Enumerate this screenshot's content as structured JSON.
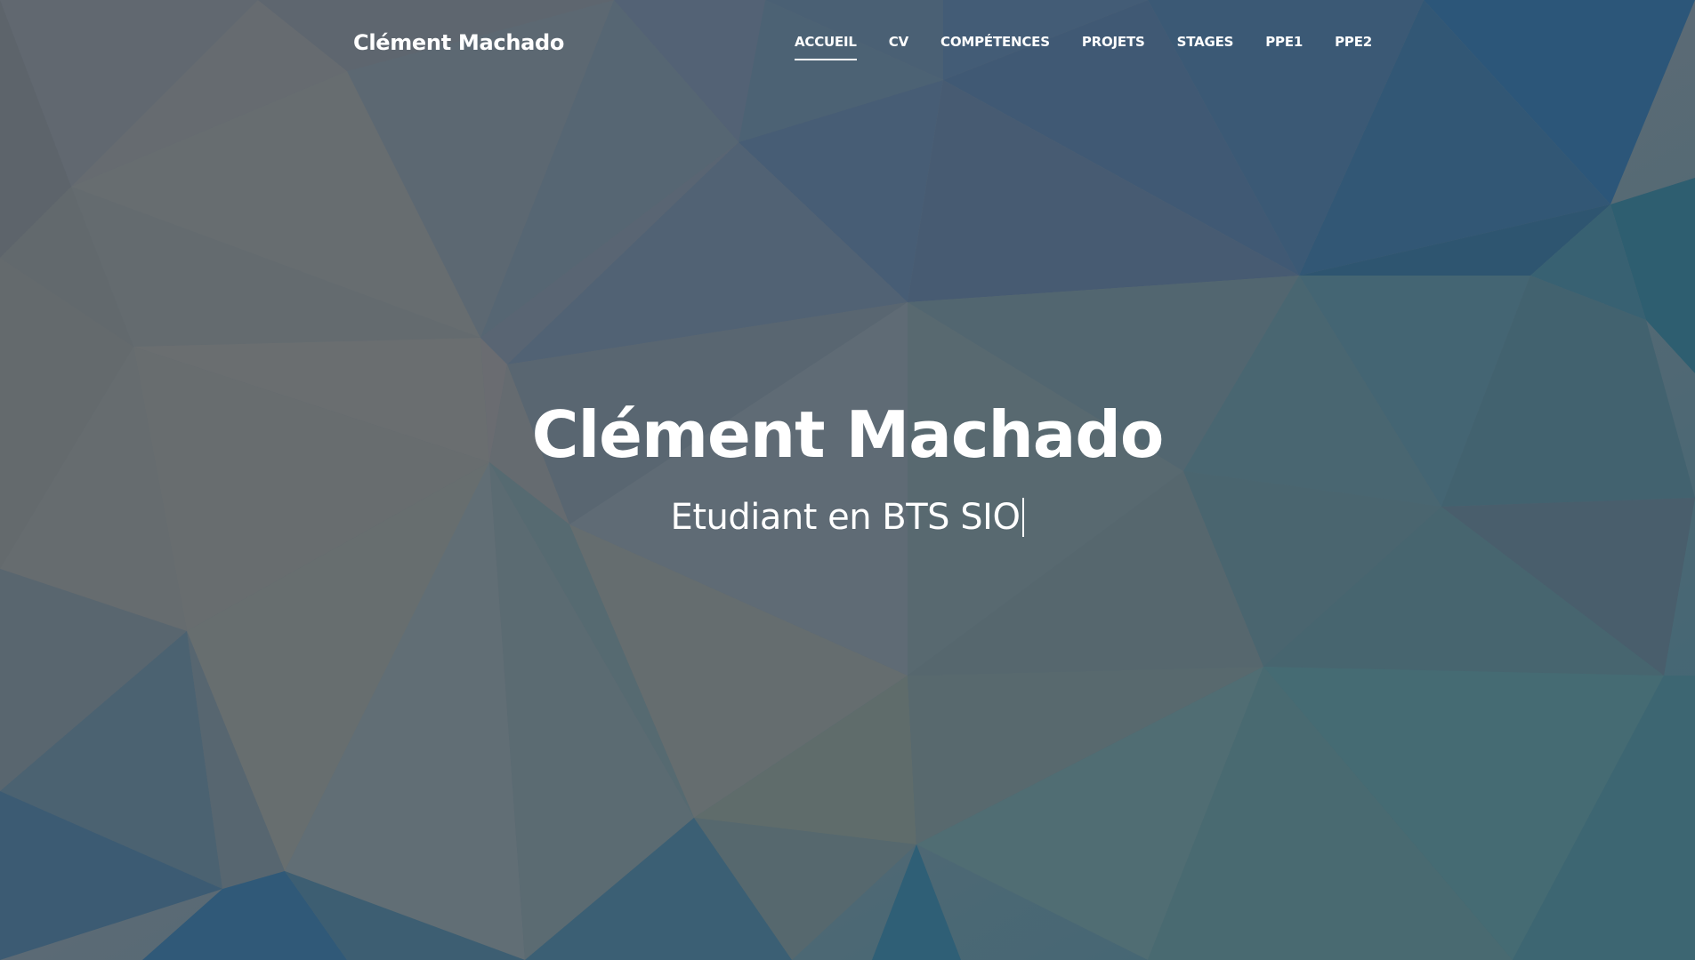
{
  "header": {
    "brand": "Clément Machado",
    "nav": [
      {
        "label": "ACCUEIL",
        "active": true
      },
      {
        "label": "CV",
        "active": false
      },
      {
        "label": "COMPÉTENCES",
        "active": false
      },
      {
        "label": "PROJETS",
        "active": false
      },
      {
        "label": "STAGES",
        "active": false
      },
      {
        "label": "PPE1",
        "active": false
      },
      {
        "label": "PPE2",
        "active": false
      }
    ]
  },
  "hero": {
    "title": "Clément Machado",
    "subtitle": "Etudiant en BTS SIO"
  },
  "colors": {
    "text": "#ffffff",
    "background_gray": "#6b7274",
    "background_blue": "#2e5f80",
    "background_teal": "#3f6f78"
  }
}
